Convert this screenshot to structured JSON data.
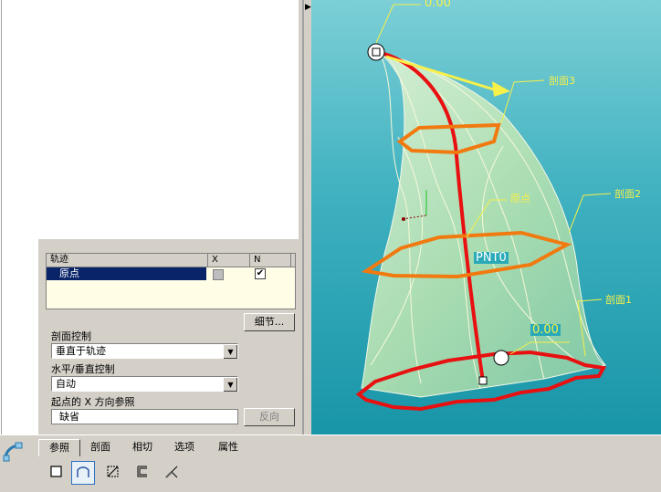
{
  "model_tree": {
    "items": []
  },
  "viewport": {
    "annotations": {
      "top_dim": "0.00",
      "lower_dim": "0.00",
      "section3": "剖面3",
      "section2": "剖面2",
      "section1": "剖面1",
      "origin": "原点",
      "pnt0": "PNT0"
    },
    "colors": {
      "trajectory": "#e81010",
      "section": "#f07a10",
      "arrow": "#f6f04a",
      "surface": "#d6f0c0"
    }
  },
  "trajectory_panel": {
    "columns": {
      "name": "轨迹",
      "x": "X",
      "n": "N"
    },
    "rows": [
      {
        "name": "原点",
        "x_checked": false,
        "n_checked": true
      }
    ],
    "details_button": "细节...",
    "section_control_label": "剖面控制",
    "section_control_value": "垂直于轨迹",
    "hv_control_label": "水平/垂直控制",
    "hv_control_value": "自动",
    "start_x_ref_label": "起点的 X 方向参照",
    "start_x_ref_value": "缺省",
    "flip_button": "反向"
  },
  "dashboard": {
    "tabs": [
      "参照",
      "剖面",
      "相切",
      "选项",
      "属性"
    ],
    "active_tab": "参照",
    "tools": [
      "solid-icon",
      "surface-icon",
      "cut-icon",
      "thicken-icon",
      "transform-icon"
    ],
    "active_tool": "surface-icon"
  }
}
